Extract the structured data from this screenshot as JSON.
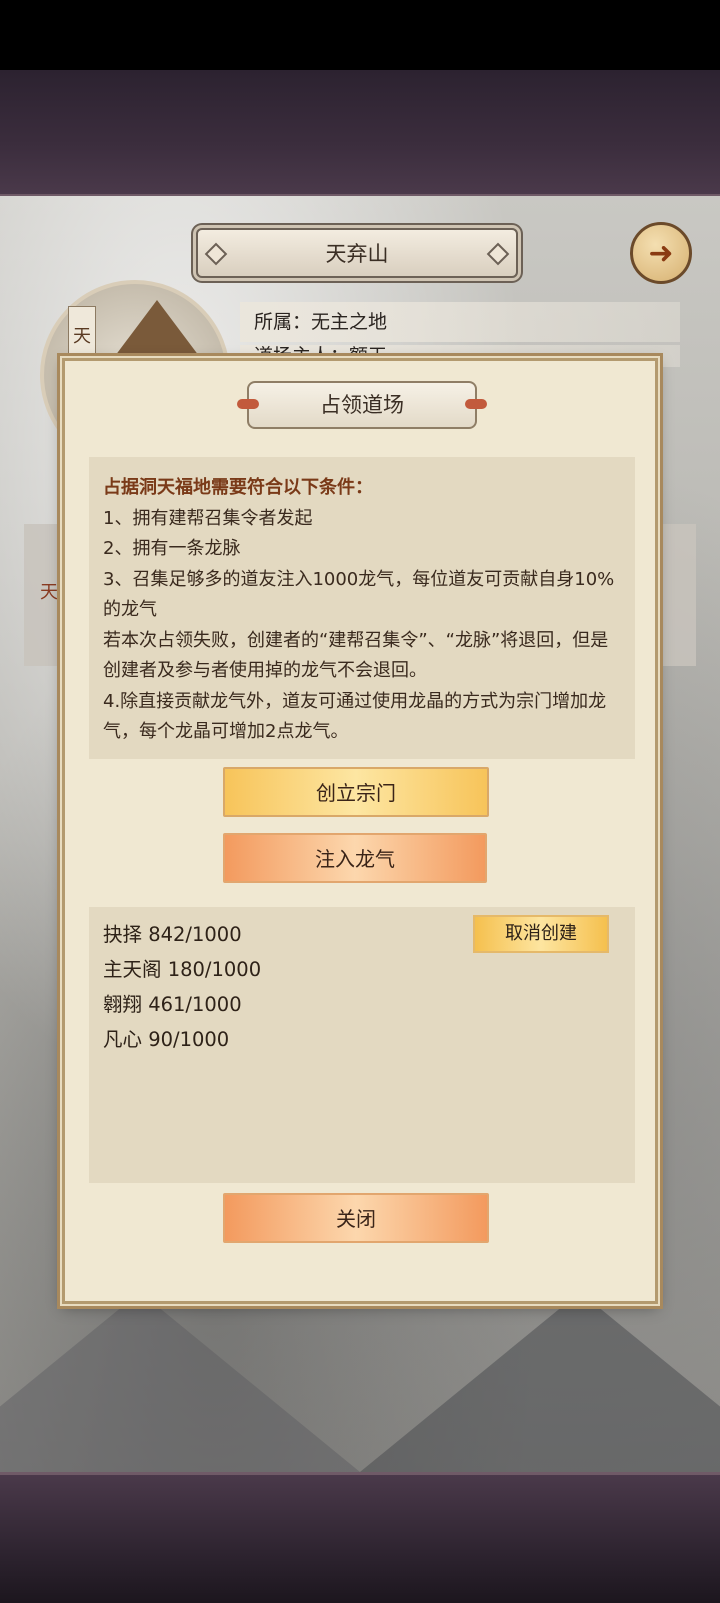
{
  "location": {
    "title": "天弃山",
    "affiliation": "所属：无主之地",
    "owner_partial": "道场主人：额天",
    "scroll_char": "天",
    "side_char": "天"
  },
  "dialog": {
    "title": "占领道场",
    "rules": [
      "占据洞天福地需要符合以下条件：",
      "1、拥有建帮召集令者发起",
      "2、拥有一条龙脉",
      "3、召集足够多的道友注入1000龙气，每位道友可贡献自身10%的龙气",
      "若本次占领失败，创建者的“建帮召集令”、“龙脉”将退回，但是创建者及参与者使用掉的龙气不会退回。",
      "4.除直接贡献龙气外，道友可通过使用龙晶的方式为宗门增加龙气，每个龙晶可增加2点龙气。"
    ],
    "create_button": "创立宗门",
    "inject_button": "注入龙气",
    "cancel_button": "取消创建",
    "close_button": "关闭",
    "contributions": [
      "抉择 842/1000",
      "主天阁 180/1000",
      "翱翔 461/1000",
      "凡心 90/1000"
    ]
  },
  "icons": {
    "back": "back-arrow-icon"
  },
  "colors": {
    "accent_title": "#7a3a18",
    "gold_button": "#f7c45a",
    "orange_button": "#f39a5e",
    "panel_bg": "#f0e8d2"
  }
}
